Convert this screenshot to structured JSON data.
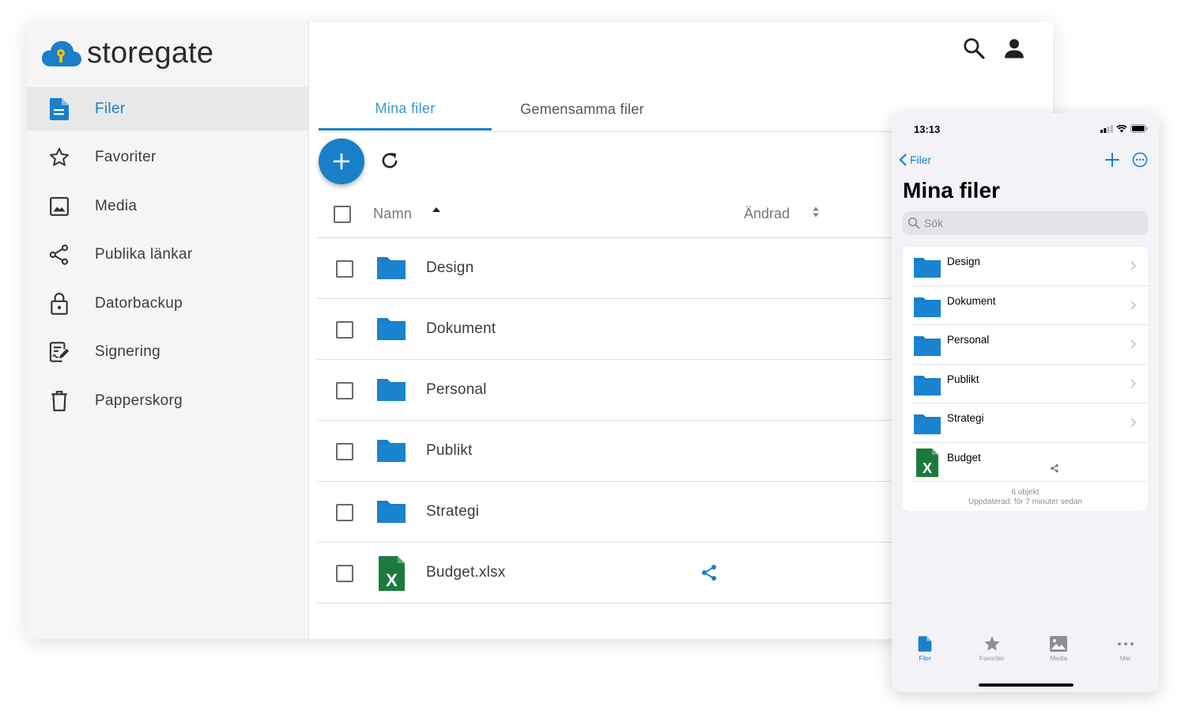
{
  "app": {
    "logo_text": "storegate",
    "brand_color": "#1a7fc9",
    "logo_keyhole_color": "#f2c200"
  },
  "sidebar": {
    "items": [
      {
        "label": "Filer",
        "icon": "document-icon",
        "active": true
      },
      {
        "label": "Favoriter",
        "icon": "star-icon",
        "active": false
      },
      {
        "label": "Media",
        "icon": "image-icon",
        "active": false
      },
      {
        "label": "Publika länkar",
        "icon": "share-icon",
        "active": false
      },
      {
        "label": "Datorbackup",
        "icon": "lock-icon",
        "active": false
      },
      {
        "label": "Signering",
        "icon": "signing-icon",
        "active": false
      },
      {
        "label": "Papperskorg",
        "icon": "trash-icon",
        "active": false
      }
    ]
  },
  "header": {
    "icons": [
      "search-icon",
      "account-icon"
    ]
  },
  "tabs": [
    {
      "label": "Mina filer",
      "active": true
    },
    {
      "label": "Gemensamma filer",
      "active": false
    }
  ],
  "toolbar": {
    "add_icon": "plus-icon",
    "refresh_icon": "refresh-icon"
  },
  "table": {
    "columns": {
      "name": "Namn",
      "changed": "Ändrad"
    },
    "rows": [
      {
        "name": "Design",
        "type": "folder"
      },
      {
        "name": "Dokument",
        "type": "folder"
      },
      {
        "name": "Personal",
        "type": "folder"
      },
      {
        "name": "Publikt",
        "type": "folder"
      },
      {
        "name": "Strategi",
        "type": "folder"
      },
      {
        "name": "Budget.xlsx",
        "type": "excel",
        "shared": true
      }
    ]
  },
  "phone": {
    "time": "13:13",
    "back_label": "Filer",
    "title": "Mina filer",
    "search_placeholder": "Sök",
    "items": [
      {
        "name": "Design",
        "type": "folder"
      },
      {
        "name": "Dokument",
        "type": "folder"
      },
      {
        "name": "Personal",
        "type": "folder"
      },
      {
        "name": "Publikt",
        "type": "folder"
      },
      {
        "name": "Strategi",
        "type": "folder"
      },
      {
        "name": "Budget",
        "type": "excel",
        "shared": true
      }
    ],
    "footer_count": "6 objekt",
    "footer_updated": "Uppdaterad: för 7 minuter sedan",
    "tabbar": [
      {
        "label": "Filer",
        "icon": "document-icon",
        "active": true
      },
      {
        "label": "Favoriter",
        "icon": "star-icon",
        "active": false
      },
      {
        "label": "Media",
        "icon": "image-icon",
        "active": false
      },
      {
        "label": "Mer",
        "icon": "more-icon",
        "active": false
      }
    ]
  }
}
